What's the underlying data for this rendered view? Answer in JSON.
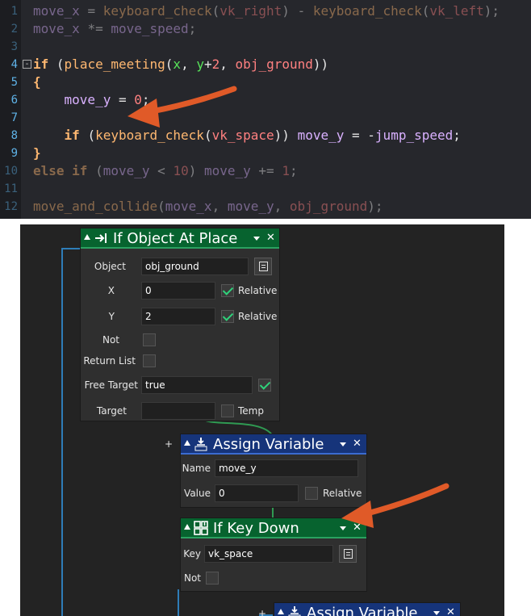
{
  "code_editor": {
    "lines": [
      {
        "n": "1",
        "dim": true,
        "text": "move_x = keyboard_check(vk_right) - keyboard_check(vk_left);"
      },
      {
        "n": "2",
        "dim": true,
        "text": "move_x *= move_speed;"
      },
      {
        "n": "3",
        "dim": true,
        "text": ""
      },
      {
        "n": "4",
        "dim": false,
        "text": "if (place_meeting(x, y+2, obj_ground))"
      },
      {
        "n": "5",
        "dim": false,
        "text": "{"
      },
      {
        "n": "6",
        "dim": false,
        "text": "    move_y = 0;"
      },
      {
        "n": "7",
        "dim": false,
        "text": ""
      },
      {
        "n": "8",
        "dim": false,
        "text": "    if (keyboard_check(vk_space)) move_y = -jump_speed;"
      },
      {
        "n": "9",
        "dim": false,
        "text": "}"
      },
      {
        "n": "10",
        "dim": true,
        "text": "else if (move_y < 10) move_y += 1;"
      },
      {
        "n": "11",
        "dim": true,
        "text": ""
      },
      {
        "n": "12",
        "dim": true,
        "text": "move_and_collide(move_x, move_y, obj_ground);"
      }
    ],
    "fold_marker": "-"
  },
  "visual_editor": {
    "if_object_at_place": {
      "title": "If Object At Place",
      "icon": "arrow-to-bar-icon",
      "close": "✕",
      "object_label": "Object",
      "object_value": "obj_ground",
      "x_label": "X",
      "x_value": "0",
      "x_relative_label": "Relative",
      "x_relative_checked": true,
      "y_label": "Y",
      "y_value": "2",
      "y_relative_label": "Relative",
      "y_relative_checked": true,
      "not_label": "Not",
      "return_list_label": "Return List",
      "free_target_label": "Free Target",
      "free_target_value": "true",
      "free_target_checked": true,
      "target_label": "Target",
      "target_value": "",
      "temp_label": "Temp"
    },
    "assign_variable_1": {
      "title": "Assign Variable",
      "icon": "var-download-icon",
      "close": "✕",
      "expand": "+",
      "name_label": "Name",
      "name_value": "move_y",
      "value_label": "Value",
      "value_value": "0",
      "relative_label": "Relative"
    },
    "if_key_down": {
      "title": "If Key Down",
      "icon": "grid-key-icon",
      "close": "✕",
      "key_label": "Key",
      "key_value": "vk_space",
      "not_label": "Not"
    },
    "assign_variable_2": {
      "title": "Assign Variable",
      "icon": "var-download-icon",
      "close": "✕",
      "expand": "+"
    }
  },
  "colors": {
    "arrow": "#e05a28",
    "action_header_green": "#07632f",
    "action_header_blue": "#16347a",
    "line_numbers": "#5fb3e8"
  }
}
